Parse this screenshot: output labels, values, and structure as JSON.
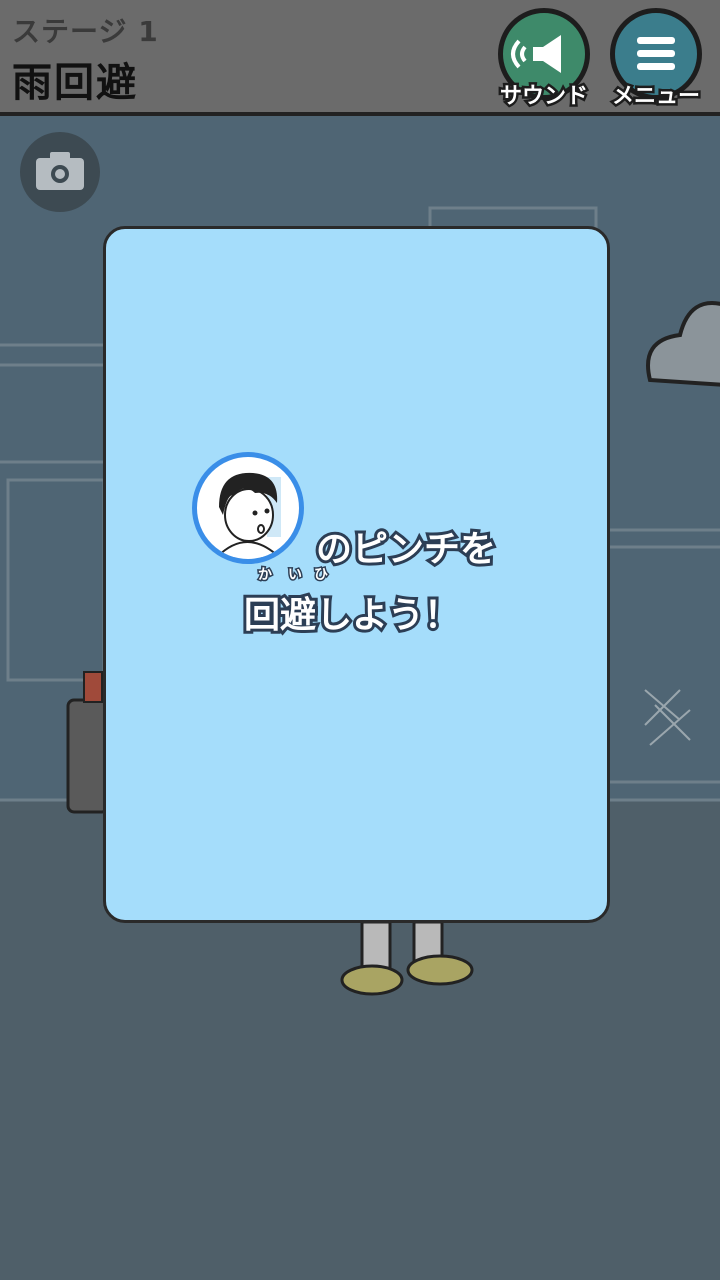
{
  "header": {
    "stage_label": "ステージ 1",
    "stage_title": "雨回避",
    "sound_button": {
      "label": "サウンド",
      "color": "#3e8a6a",
      "icon": "speaker-icon"
    },
    "menu_button": {
      "label": "メニュー",
      "color": "#3b7d8c",
      "icon": "hamburger-icon"
    }
  },
  "camera_button": {
    "icon": "camera-icon"
  },
  "dialog": {
    "line1": "のピンチを",
    "line2": "回避しよう！",
    "ruby": [
      "か",
      "い",
      "ひ"
    ],
    "background": "#a5ddfb"
  },
  "colors": {
    "scene_background": "#4f5f69",
    "header_background": "#6b6b6b",
    "avatar_ring": "#3a8ee8"
  }
}
